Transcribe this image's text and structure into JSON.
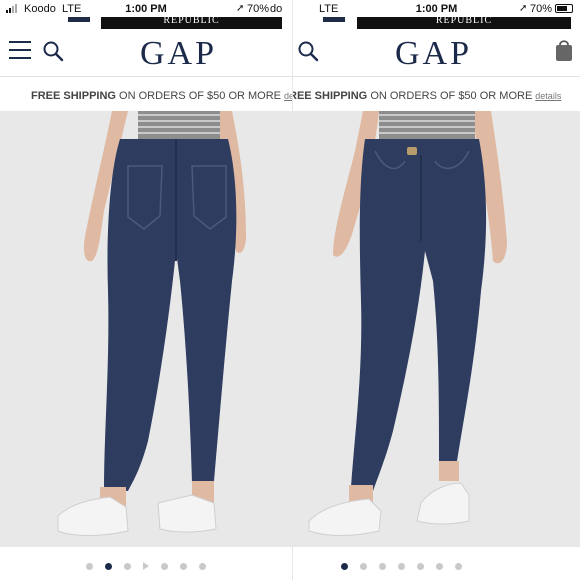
{
  "screens": [
    {
      "status": {
        "carrier": "Koodo",
        "network": "LTE",
        "time": "1:00 PM",
        "battery": "70%",
        "battery_suffix": "do"
      },
      "brand_strip": "REPUBLIC",
      "logo": "GAP",
      "shipping": {
        "bold": "FREE SHIPPING",
        "text": "ON ORDERS OF $50 OR MORE",
        "link": "details"
      },
      "image": {
        "view": "back",
        "alt": ""
      },
      "carousel": {
        "count": 7,
        "active_index": 1,
        "video_index": 3
      }
    },
    {
      "status": {
        "network": "LTE",
        "time": "1:00 PM",
        "battery": "70%",
        "battery_level": 0.7
      },
      "brand_strip": "REPUBLIC",
      "logo": "GAP",
      "shipping": {
        "bold": "REE SHIPPING",
        "text": "ON ORDERS OF $50 OR MORE",
        "link": "details"
      },
      "image": {
        "view": "front",
        "alt": ""
      },
      "carousel": {
        "count": 7,
        "active_index": 0,
        "video_index": null
      }
    }
  ],
  "icons": {
    "menu": "hamburger-menu-icon",
    "search": "search-icon",
    "bag": "shopping-bag-icon",
    "location": "location-arrow-icon"
  },
  "colors": {
    "brand_navy": "#1c2a4a",
    "denim_dark": "#2d3c5f",
    "sneaker_white": "#f4f4f4",
    "dot_inactive": "#c9c9c9"
  }
}
